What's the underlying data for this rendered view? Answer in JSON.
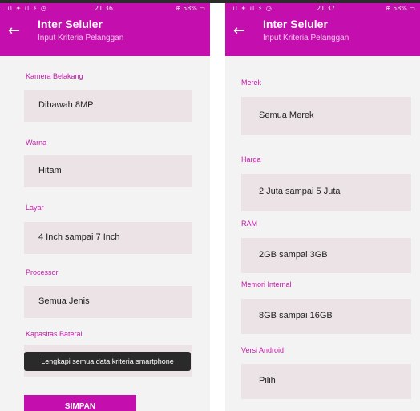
{
  "app": {
    "title": "Inter Seluler",
    "subtitle": "Input Kriteria Pelanggan",
    "back_icon": "arrow-left-icon",
    "accent": "#c40fae"
  },
  "screen1": {
    "status": {
      "signal": ".ıl ✦ ıl ⚡ ◷",
      "time": "21.36",
      "battery": "⊕ 58% ▭"
    },
    "fields": [
      {
        "label": "Kamera Belakang",
        "value": "Dibawah 8MP"
      },
      {
        "label": "Warna",
        "value": "Hitam"
      },
      {
        "label": "Layar",
        "value": "4 Inch sampai 7 Inch"
      },
      {
        "label": "Processor",
        "value": "Semua Jenis"
      },
      {
        "label": "Kapasitas Baterai",
        "value": ""
      }
    ],
    "toast": "Lengkapi semua data kriteria smartphone",
    "save_label": "SIMPAN"
  },
  "screen2": {
    "status": {
      "signal": ".ıl ✦ ıl ⚡ ◷",
      "time": "21.37",
      "battery": "⊕ 58% ▭"
    },
    "fields": [
      {
        "label": "Merek",
        "value": "Semua Merek"
      },
      {
        "label": "Harga",
        "value": "2 Juta sampai 5 Juta"
      },
      {
        "label": "RAM",
        "value": "2GB sampai 3GB"
      },
      {
        "label": "Memori Internal",
        "value": "8GB sampai 16GB"
      },
      {
        "label": "Versi Android",
        "value": "Pilih"
      }
    ]
  }
}
